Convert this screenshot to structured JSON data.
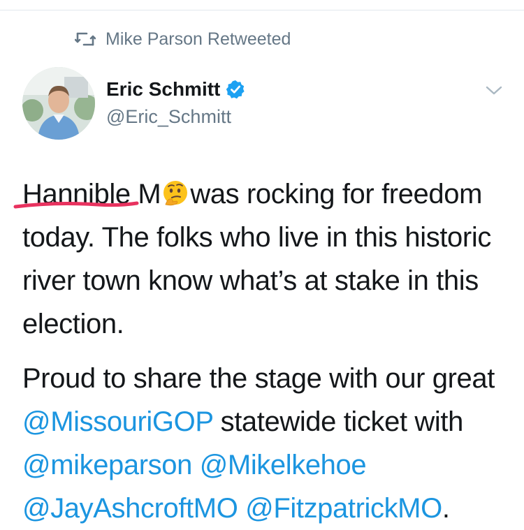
{
  "retweet": {
    "icon": "retweet-icon",
    "text": "Mike Parson Retweeted"
  },
  "author": {
    "display_name": "Eric Schmitt",
    "handle": "@Eric_Schmitt",
    "verified_icon": "verified-badge-icon",
    "avatar": "avatar"
  },
  "menu": {
    "icon": "chevron-down-icon"
  },
  "tweet": {
    "line1": {
      "underlined_word": "Hannible",
      "after_word": " M",
      "emoji_name": "thinking-face-emoji",
      "after_emoji": "was rocking for"
    },
    "para1_rest": "freedom today. The folks who live in this historic river town know what’s at stake in this election.",
    "para2": {
      "t1": "Proud to share the stage with our great ",
      "m1": "@MissouriGOP",
      "t2": " statewide ticket with ",
      "m2": "@mikeparson",
      "t3": " ",
      "m3": "@Mikelkehoe",
      "t4": " ",
      "m4": "@JayAshcroftMO",
      "t5": " ",
      "m5": "@FitzpatrickMO",
      "t6": "."
    }
  },
  "colors": {
    "link": "#1b95e0",
    "secondary_text": "#657786",
    "verified": "#1da1f2",
    "annotation_underline": "#e8325f"
  }
}
